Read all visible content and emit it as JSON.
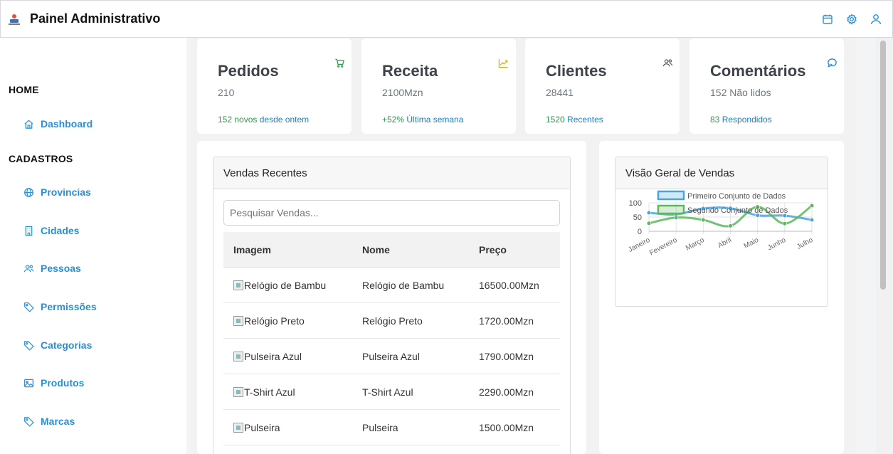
{
  "header": {
    "title": "Painel Administrativo",
    "icons": [
      "calendar-icon",
      "gear-icon",
      "user-icon"
    ],
    "accent": "#2b8fd6"
  },
  "sidebar": {
    "sections": [
      {
        "title": "HOME",
        "items": [
          {
            "label": "Dashboard",
            "icon": "home-icon"
          }
        ]
      },
      {
        "title": "CADASTROS",
        "items": [
          {
            "label": "Provincias",
            "icon": "globe-icon"
          },
          {
            "label": "Cidades",
            "icon": "building-icon"
          },
          {
            "label": "Pessoas",
            "icon": "people-icon"
          },
          {
            "label": "Permissões",
            "icon": "tag-icon"
          },
          {
            "label": "Categorias",
            "icon": "tag-icon"
          },
          {
            "label": "Produtos",
            "icon": "image-icon"
          },
          {
            "label": "Marcas",
            "icon": "tag-icon"
          }
        ]
      }
    ]
  },
  "stats": [
    {
      "title": "Pedidos",
      "value": "210",
      "foot_a": "152 novos",
      "foot_b": "desde ontem",
      "icon": "cart-icon"
    },
    {
      "title": "Receita",
      "value": "2100Mzn",
      "foot_a": "+52%",
      "foot_b": "Última semana",
      "icon": "trending-up-icon"
    },
    {
      "title": "Clientes",
      "value": "28441",
      "foot_a": "1520",
      "foot_b": "Recentes",
      "icon": "people-icon"
    },
    {
      "title": "Comentários",
      "value": "152 Não lidos",
      "foot_a": "83",
      "foot_b": "Respondidos",
      "icon": "chat-icon"
    }
  ],
  "sales": {
    "title": "Vendas Recentes",
    "search_placeholder": "Pesquisar Vendas...",
    "columns": [
      "Imagem",
      "Nome",
      "Preço"
    ],
    "rows": [
      {
        "image_alt": "Relógio de Bambu",
        "name": "Relógio de Bambu",
        "price": "16500.00Mzn"
      },
      {
        "image_alt": "Relógio Preto",
        "name": "Relógio Preto",
        "price": "1720.00Mzn"
      },
      {
        "image_alt": "Pulseira Azul",
        "name": "Pulseira Azul",
        "price": "1790.00Mzn"
      },
      {
        "image_alt": "T-Shirt Azul",
        "name": "T-Shirt Azul",
        "price": "2290.00Mzn"
      },
      {
        "image_alt": "Pulseira",
        "name": "Pulseira",
        "price": "1500.00Mzn"
      }
    ]
  },
  "overview": {
    "title": "Visão Geral de Vendas"
  },
  "chart_data": {
    "type": "line",
    "categories": [
      "Janeiro",
      "Fevereiro",
      "Março",
      "Abril",
      "Maio",
      "Junho",
      "Julho"
    ],
    "series": [
      {
        "name": "Primeiro Conjunto de Dados",
        "values": [
          65,
          59,
          80,
          81,
          56,
          55,
          40
        ],
        "color": "#4aa3df"
      },
      {
        "name": "Segundo Conjunto de Dados",
        "values": [
          28,
          48,
          40,
          19,
          86,
          27,
          90
        ],
        "color": "#5cb85c"
      }
    ],
    "yticks": [
      "100",
      "50",
      "0"
    ],
    "ylim": [
      0,
      100
    ],
    "legend": "top",
    "grid": true
  }
}
